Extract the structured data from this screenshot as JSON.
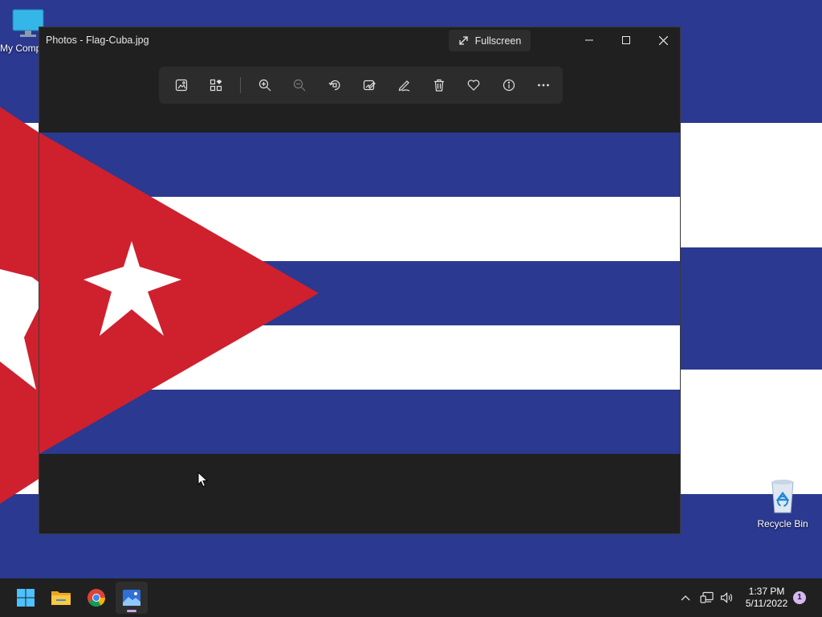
{
  "desktop": {
    "icons": [
      {
        "label": "My Computer",
        "icon": "computer-icon"
      },
      {
        "label": "Recycle Bin",
        "icon": "recycle-bin-icon"
      }
    ],
    "wallpaper": "cuba-flag"
  },
  "window": {
    "title": "Photos - Flag-Cuba.jpg",
    "fullscreen_label": "Fullscreen",
    "toolbar": [
      {
        "icon": "view-image-icon",
        "tooltip": ""
      },
      {
        "icon": "gallery-icon",
        "tooltip": ""
      },
      {
        "icon": "zoom-in-icon",
        "tooltip": ""
      },
      {
        "icon": "zoom-out-icon",
        "tooltip": ""
      },
      {
        "icon": "rotate-icon",
        "tooltip": ""
      },
      {
        "icon": "edit-image-icon",
        "tooltip": ""
      },
      {
        "icon": "draw-icon",
        "tooltip": ""
      },
      {
        "icon": "delete-icon",
        "tooltip": ""
      },
      {
        "icon": "favorite-icon",
        "tooltip": ""
      },
      {
        "icon": "info-icon",
        "tooltip": ""
      },
      {
        "icon": "more-icon",
        "tooltip": ""
      }
    ],
    "image": "Flag-Cuba.jpg"
  },
  "taskbar": {
    "apps": [
      "Start",
      "File Explorer",
      "Google Chrome",
      "Photos"
    ],
    "clock": {
      "time": "1:37 PM",
      "date": "5/11/2022"
    },
    "notification_count": "1"
  },
  "colors": {
    "flag_blue": "#2b3990",
    "flag_red": "#cf202e",
    "window_bg": "#202020",
    "taskbar_bg": "#202020"
  }
}
